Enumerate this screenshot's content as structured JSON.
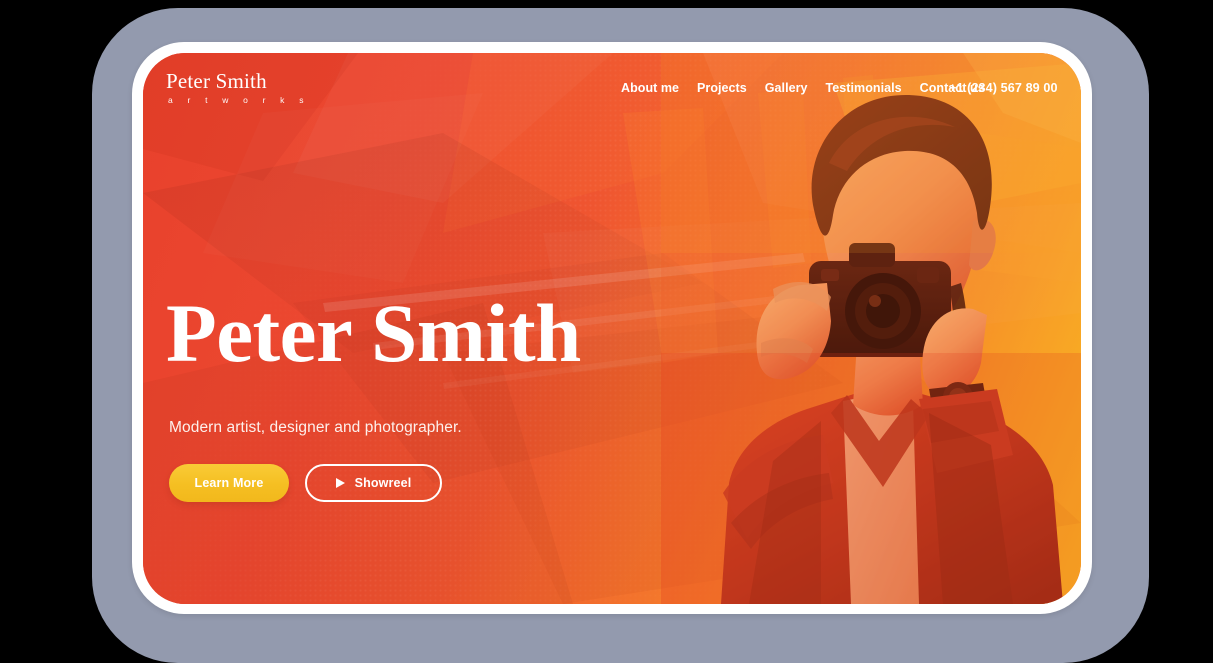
{
  "device": {
    "bezel_color": "#939aae",
    "frame_color": "#ffffff",
    "backdrop_color": "#000000"
  },
  "site": {
    "theme": {
      "background_red": "#ef4a31",
      "background_orange": "#f79029",
      "background_yellow": "#fdd321",
      "accent_button": "#f5c229",
      "text_on_dark": "#ffffff"
    },
    "logo": {
      "name": "Peter Smith",
      "tagline": "a r t w o r k s"
    },
    "nav": {
      "items": [
        {
          "label": "About me"
        },
        {
          "label": "Projects"
        },
        {
          "label": "Gallery"
        },
        {
          "label": "Testimonials"
        },
        {
          "label": "Contact us"
        }
      ],
      "phone": "+1 (234) 567 89 00"
    },
    "hero": {
      "title": "Peter Smith",
      "subtitle": "Modern artist, designer and photographer.",
      "primary_button": "Learn More",
      "secondary_button": "Showreel",
      "secondary_button_icon": "play-icon"
    },
    "photo": {
      "alt": "photographer-holding-film-camera",
      "treatment": "duotone-orange"
    }
  }
}
